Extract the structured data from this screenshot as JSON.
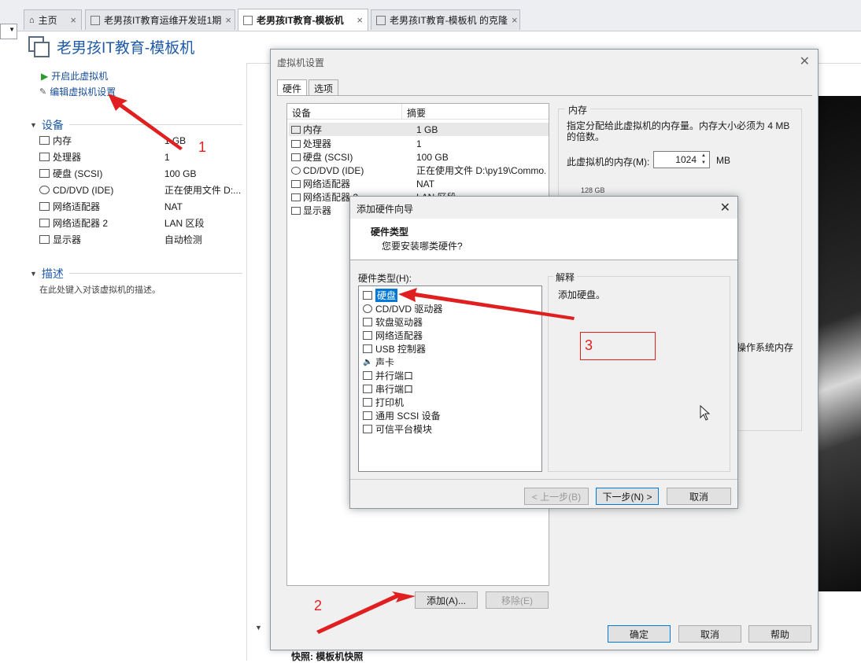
{
  "tabs": [
    {
      "label": "主页",
      "close": "×"
    },
    {
      "label": "老男孩IT教育运维开发班1期",
      "close": "×"
    },
    {
      "label": "老男孩IT教育-模板机",
      "close": "×"
    },
    {
      "label": "老男孩IT教育-模板机 的克隆",
      "close": "×"
    }
  ],
  "page": {
    "title": "老男孩IT教育-模板机"
  },
  "actions": {
    "power_on": "开启此虚拟机",
    "edit_settings": "编辑虚拟机设置"
  },
  "devices": {
    "section_title": "设备",
    "rows": [
      {
        "name": "内存",
        "value": "1 GB",
        "icon": "memory-icon"
      },
      {
        "name": "处理器",
        "value": "1",
        "icon": "cpu-icon"
      },
      {
        "name": "硬盘 (SCSI)",
        "value": "100 GB",
        "icon": "disk-icon"
      },
      {
        "name": "CD/DVD (IDE)",
        "value": "正在使用文件 D:...",
        "icon": "cd-icon"
      },
      {
        "name": "网络适配器",
        "value": "NAT",
        "icon": "network-icon"
      },
      {
        "name": "网络适配器 2",
        "value": "LAN 区段",
        "icon": "network-icon"
      },
      {
        "name": "显示器",
        "value": "自动检测",
        "icon": "monitor-icon"
      }
    ]
  },
  "description": {
    "section_title": "描述",
    "placeholder": "在此处键入对该虚拟机的描述。"
  },
  "bottom": {
    "snapshot": "快照: 模板机快照"
  },
  "vm_settings": {
    "title": "虚拟机设置",
    "tabs": [
      "硬件",
      "选项"
    ],
    "columns": [
      "设备",
      "摘要"
    ],
    "rows": [
      {
        "name": "内存",
        "value": "1 GB"
      },
      {
        "name": "处理器",
        "value": "1"
      },
      {
        "name": "硬盘 (SCSI)",
        "value": "100 GB"
      },
      {
        "name": "CD/DVD (IDE)",
        "value": "正在使用文件 D:\\py19\\Commo..."
      },
      {
        "name": "网络适配器",
        "value": "NAT"
      },
      {
        "name": "网络适配器 2",
        "value": "LAN 区段"
      },
      {
        "name": "显示器",
        "value": ""
      }
    ],
    "memory": {
      "group_title": "内存",
      "description": "指定分配给此虚拟机的内存量。内存大小必须为 4 MB 的倍数。",
      "label": "此虚拟机的内存(M):",
      "value": "1024",
      "unit": "MB",
      "tick": "128 GB",
      "side_text": "操作系统内存"
    },
    "buttons": {
      "add": "添加(A)...",
      "remove": "移除(E)",
      "ok": "确定",
      "cancel": "取消",
      "help": "帮助"
    }
  },
  "wizard": {
    "title": "添加硬件向导",
    "heading": "硬件类型",
    "subheading": "您要安装哪类硬件?",
    "list_label": "硬件类型(H):",
    "items": [
      {
        "label": "硬盘",
        "icon": "disk-icon",
        "selected": true
      },
      {
        "label": "CD/DVD 驱动器",
        "icon": "cd-icon"
      },
      {
        "label": "软盘驱动器",
        "icon": "floppy-icon"
      },
      {
        "label": "网络适配器",
        "icon": "network-icon"
      },
      {
        "label": "USB 控制器",
        "icon": "usb-icon"
      },
      {
        "label": "声卡",
        "icon": "speaker-icon"
      },
      {
        "label": "并行端口",
        "icon": "parallel-port-icon"
      },
      {
        "label": "串行端口",
        "icon": "serial-port-icon"
      },
      {
        "label": "打印机",
        "icon": "printer-icon"
      },
      {
        "label": "通用 SCSI 设备",
        "icon": "scsi-icon"
      },
      {
        "label": "可信平台模块",
        "icon": "tpm-icon"
      }
    ],
    "explanation_title": "解释",
    "explanation_text": "添加硬盘。",
    "buttons": {
      "back": "< 上一步(B)",
      "next": "下一步(N) >",
      "cancel": "取消"
    }
  },
  "annotations": {
    "n1": "1",
    "n2": "2",
    "n3": "3"
  },
  "colors": {
    "accent": "#1e5aa8",
    "annotation": "#e02020",
    "selection": "#0078d7"
  }
}
